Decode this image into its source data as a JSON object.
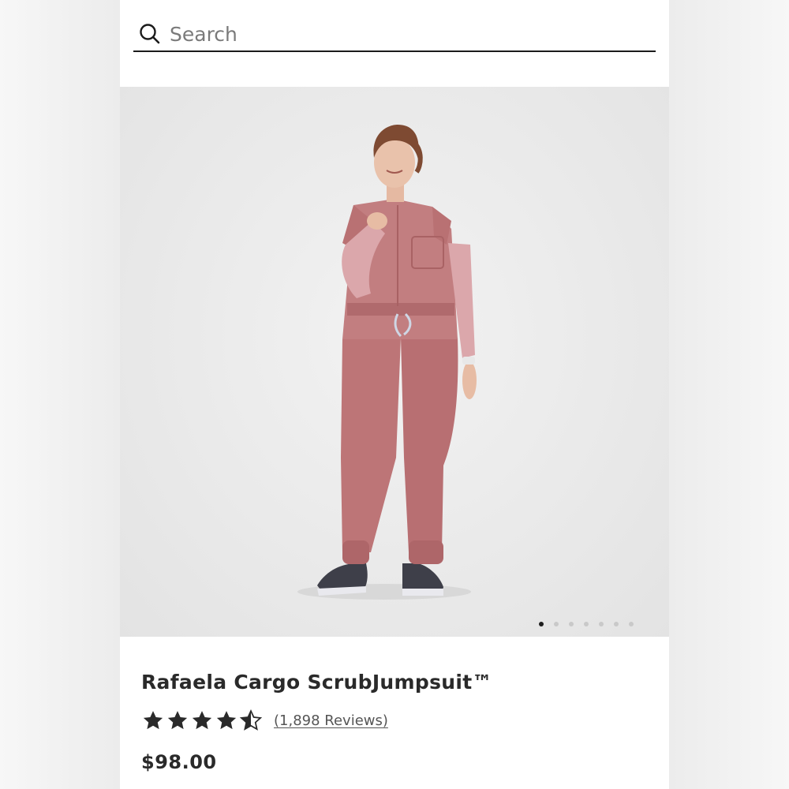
{
  "search": {
    "placeholder": "Search",
    "icon": "search-icon"
  },
  "gallery": {
    "slide_count": 7,
    "active_slide": 1,
    "image_subject": "model wearing the product"
  },
  "product": {
    "title": "Rafaela Cargo ScrubJumpsuit™",
    "rating": 4.5,
    "reviews_label": "(1,898 Reviews)",
    "price": "$98.00"
  },
  "colors": {
    "product": "#c07a7c",
    "text": "#2a2a2a",
    "background": "#ffffff"
  }
}
